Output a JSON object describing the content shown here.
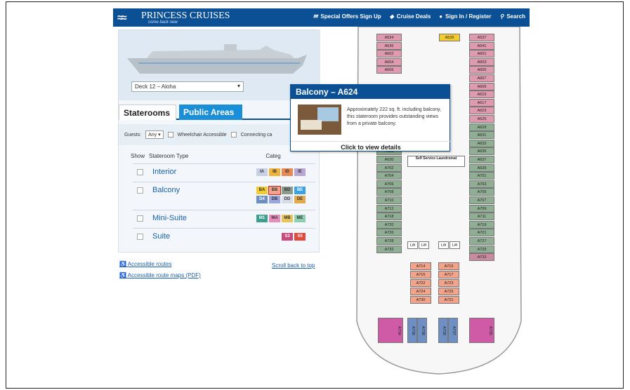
{
  "header": {
    "logo_name": "PRINCESS CRUISES",
    "logo_tagline": "come back new",
    "nav": [
      {
        "label": "Special Offers Sign Up",
        "icon": "envelope-icon"
      },
      {
        "label": "Cruise Deals",
        "icon": "tag-icon"
      },
      {
        "label": "Sign In / Register",
        "icon": "user-icon"
      },
      {
        "label": "Search",
        "icon": "search-icon"
      }
    ]
  },
  "deck_selector": {
    "value": "Deck 12 – Aloha"
  },
  "tabs": [
    {
      "label": "Staterooms"
    },
    {
      "label": "Public Areas"
    }
  ],
  "filters": {
    "guests_label": "Guests:",
    "guests_value": "Any",
    "wheelchair_label": "Wheelchair Accessible",
    "connecting_label": "Connecting ca"
  },
  "list_header": {
    "show": "Show",
    "type": "Stateroom Type",
    "category": "Categ"
  },
  "room_types": [
    {
      "name": "Interior",
      "chips": [
        {
          "code": "IA",
          "color": "#c9cfe4"
        },
        {
          "code": "IB",
          "color": "#f0b33a"
        },
        {
          "code": "ID",
          "color": "#e98a55"
        },
        {
          "code": "IE",
          "color": "#b8a6d3"
        }
      ]
    },
    {
      "name": "Balcony",
      "chips": [
        {
          "code": "BA",
          "color": "#f2cc2e"
        },
        {
          "code": "BB",
          "color": "#f0a58a"
        },
        {
          "code": "BD",
          "color": "#8c9a8c"
        },
        {
          "code": "BE",
          "color": "#3ba3e0"
        },
        {
          "code": "D4",
          "color": "#6d8fc4"
        },
        {
          "code": "DB",
          "color": "#9aa6dd"
        },
        {
          "code": "DD",
          "color": "#d7dde6"
        },
        {
          "code": "DE",
          "color": "#e5a94a"
        }
      ]
    },
    {
      "name": "Mini-Suite",
      "chips": [
        {
          "code": "M1",
          "color": "#3f9f8e"
        },
        {
          "code": "MA",
          "color": "#e88cb9"
        },
        {
          "code": "MB",
          "color": "#e9c35b"
        },
        {
          "code": "ME",
          "color": "#8ecfb2"
        }
      ]
    },
    {
      "name": "Suite",
      "chips": [
        {
          "code": "S3",
          "color": "#c9497c"
        },
        {
          "code": "S5",
          "color": "#e24a3c"
        }
      ]
    }
  ],
  "links": {
    "accessible_routes": "Accessible routes",
    "accessible_route_maps": "Accessible route maps (PDF)",
    "scroll_back": "Scroll back to top"
  },
  "popup": {
    "title": "Balcony – A624",
    "description": "Approximately 222 sq. ft. including balcony, this stateroom provides outstanding views from a private balcony.",
    "cta": "Click to view details"
  },
  "deck_plan": {
    "left_column": [
      "A534",
      "A536",
      "A602",
      "A604",
      "A606",
      "",
      "",
      "",
      "",
      "",
      "",
      "A622",
      "A624",
      "A626",
      "A628",
      "A630",
      "A702",
      "A704",
      "A706",
      "A708",
      "A710",
      "A712",
      "A718",
      "A720",
      "A726",
      "A728",
      "A732"
    ],
    "right_column": [
      "A537",
      "A541",
      "A601",
      "A603",
      "A605",
      "A607",
      "A609",
      "A615",
      "A617",
      "A623",
      "A625",
      "A629",
      "A631",
      "A633",
      "A635",
      "A637",
      "A639",
      "A701",
      "A703",
      "A705",
      "A707",
      "A709",
      "A711",
      "A719",
      "A721",
      "A727",
      "A729",
      "A733"
    ],
    "inner_top_label": "A539",
    "inner_left": [
      "A714",
      "A716",
      "A722",
      "A724",
      "A730"
    ],
    "inner_right": [
      "A715",
      "A717",
      "A723",
      "A725",
      "A731"
    ],
    "bow_cabins": [
      "A734",
      "A736",
      "A738",
      "A739",
      "A737",
      "A735"
    ],
    "service_label": "Self Service Laundromat",
    "lift_labels": [
      "Lift",
      "Lift",
      "Lift",
      "Lift"
    ],
    "selected": "A624"
  }
}
